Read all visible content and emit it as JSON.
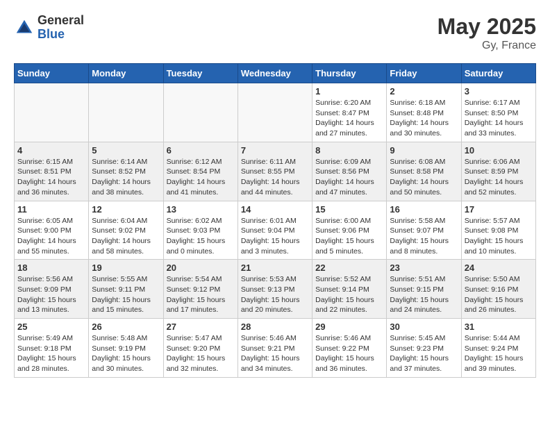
{
  "header": {
    "logo_line1": "General",
    "logo_line2": "Blue",
    "title": "May 2025",
    "subtitle": "Gy, France"
  },
  "weekdays": [
    "Sunday",
    "Monday",
    "Tuesday",
    "Wednesday",
    "Thursday",
    "Friday",
    "Saturday"
  ],
  "weeks": [
    [
      {
        "date": "",
        "info": ""
      },
      {
        "date": "",
        "info": ""
      },
      {
        "date": "",
        "info": ""
      },
      {
        "date": "",
        "info": ""
      },
      {
        "date": "1",
        "info": "Sunrise: 6:20 AM\nSunset: 8:47 PM\nDaylight: 14 hours and 27 minutes."
      },
      {
        "date": "2",
        "info": "Sunrise: 6:18 AM\nSunset: 8:48 PM\nDaylight: 14 hours and 30 minutes."
      },
      {
        "date": "3",
        "info": "Sunrise: 6:17 AM\nSunset: 8:50 PM\nDaylight: 14 hours and 33 minutes."
      }
    ],
    [
      {
        "date": "4",
        "info": "Sunrise: 6:15 AM\nSunset: 8:51 PM\nDaylight: 14 hours and 36 minutes."
      },
      {
        "date": "5",
        "info": "Sunrise: 6:14 AM\nSunset: 8:52 PM\nDaylight: 14 hours and 38 minutes."
      },
      {
        "date": "6",
        "info": "Sunrise: 6:12 AM\nSunset: 8:54 PM\nDaylight: 14 hours and 41 minutes."
      },
      {
        "date": "7",
        "info": "Sunrise: 6:11 AM\nSunset: 8:55 PM\nDaylight: 14 hours and 44 minutes."
      },
      {
        "date": "8",
        "info": "Sunrise: 6:09 AM\nSunset: 8:56 PM\nDaylight: 14 hours and 47 minutes."
      },
      {
        "date": "9",
        "info": "Sunrise: 6:08 AM\nSunset: 8:58 PM\nDaylight: 14 hours and 50 minutes."
      },
      {
        "date": "10",
        "info": "Sunrise: 6:06 AM\nSunset: 8:59 PM\nDaylight: 14 hours and 52 minutes."
      }
    ],
    [
      {
        "date": "11",
        "info": "Sunrise: 6:05 AM\nSunset: 9:00 PM\nDaylight: 14 hours and 55 minutes."
      },
      {
        "date": "12",
        "info": "Sunrise: 6:04 AM\nSunset: 9:02 PM\nDaylight: 14 hours and 58 minutes."
      },
      {
        "date": "13",
        "info": "Sunrise: 6:02 AM\nSunset: 9:03 PM\nDaylight: 15 hours and 0 minutes."
      },
      {
        "date": "14",
        "info": "Sunrise: 6:01 AM\nSunset: 9:04 PM\nDaylight: 15 hours and 3 minutes."
      },
      {
        "date": "15",
        "info": "Sunrise: 6:00 AM\nSunset: 9:06 PM\nDaylight: 15 hours and 5 minutes."
      },
      {
        "date": "16",
        "info": "Sunrise: 5:58 AM\nSunset: 9:07 PM\nDaylight: 15 hours and 8 minutes."
      },
      {
        "date": "17",
        "info": "Sunrise: 5:57 AM\nSunset: 9:08 PM\nDaylight: 15 hours and 10 minutes."
      }
    ],
    [
      {
        "date": "18",
        "info": "Sunrise: 5:56 AM\nSunset: 9:09 PM\nDaylight: 15 hours and 13 minutes."
      },
      {
        "date": "19",
        "info": "Sunrise: 5:55 AM\nSunset: 9:11 PM\nDaylight: 15 hours and 15 minutes."
      },
      {
        "date": "20",
        "info": "Sunrise: 5:54 AM\nSunset: 9:12 PM\nDaylight: 15 hours and 17 minutes."
      },
      {
        "date": "21",
        "info": "Sunrise: 5:53 AM\nSunset: 9:13 PM\nDaylight: 15 hours and 20 minutes."
      },
      {
        "date": "22",
        "info": "Sunrise: 5:52 AM\nSunset: 9:14 PM\nDaylight: 15 hours and 22 minutes."
      },
      {
        "date": "23",
        "info": "Sunrise: 5:51 AM\nSunset: 9:15 PM\nDaylight: 15 hours and 24 minutes."
      },
      {
        "date": "24",
        "info": "Sunrise: 5:50 AM\nSunset: 9:16 PM\nDaylight: 15 hours and 26 minutes."
      }
    ],
    [
      {
        "date": "25",
        "info": "Sunrise: 5:49 AM\nSunset: 9:18 PM\nDaylight: 15 hours and 28 minutes."
      },
      {
        "date": "26",
        "info": "Sunrise: 5:48 AM\nSunset: 9:19 PM\nDaylight: 15 hours and 30 minutes."
      },
      {
        "date": "27",
        "info": "Sunrise: 5:47 AM\nSunset: 9:20 PM\nDaylight: 15 hours and 32 minutes."
      },
      {
        "date": "28",
        "info": "Sunrise: 5:46 AM\nSunset: 9:21 PM\nDaylight: 15 hours and 34 minutes."
      },
      {
        "date": "29",
        "info": "Sunrise: 5:46 AM\nSunset: 9:22 PM\nDaylight: 15 hours and 36 minutes."
      },
      {
        "date": "30",
        "info": "Sunrise: 5:45 AM\nSunset: 9:23 PM\nDaylight: 15 hours and 37 minutes."
      },
      {
        "date": "31",
        "info": "Sunrise: 5:44 AM\nSunset: 9:24 PM\nDaylight: 15 hours and 39 minutes."
      }
    ]
  ]
}
